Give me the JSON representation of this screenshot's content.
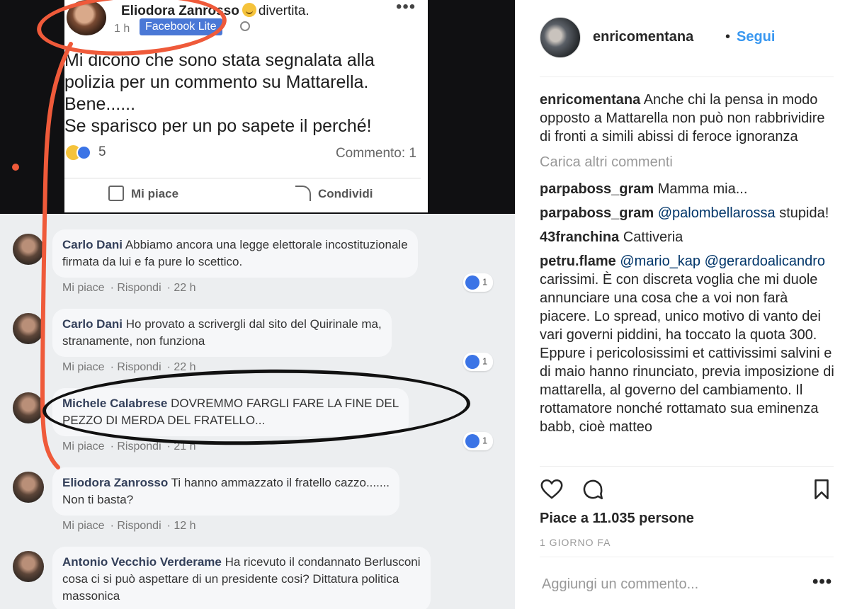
{
  "facebook_post": {
    "author": "Eliodora Zanrosso",
    "feeling": "divertita.",
    "time": "1 h",
    "app_badge": "Facebook Lite",
    "more": "•••",
    "lines": [
      "Mi dicono che sono stata segnalata alla",
      "polizia per un commento su Mattarella.",
      "Bene......",
      "Se sparisco per un po sapete il perché!"
    ],
    "reactions_count": "5",
    "comments_count": "Commento: 1",
    "like_label": "Mi piace",
    "share_label": "Condividi"
  },
  "facebook_comments": [
    {
      "name": "Carlo Dani",
      "text_lines": [
        "Abbiamo ancora una legge elettorale incostituzionale",
        "firmata da lui e fa pure lo scettico."
      ],
      "like": "Mi piace",
      "reply": "Rispondi",
      "time": "22 h",
      "reactions": "1"
    },
    {
      "name": "Carlo Dani",
      "text_lines": [
        "Ho provato a scrivergli dal sito del Quirinale ma,",
        "stranamente, non funziona"
      ],
      "like": "Mi piace",
      "reply": "Rispondi",
      "time": "22 h",
      "reactions": "1"
    },
    {
      "name": "Michele Calabrese",
      "text_lines": [
        "DOVREMMO FARGLI FARE LA FINE DEL",
        "PEZZO DI MERDA DEL FRATELLO..."
      ],
      "like": "Mi piace",
      "reply": "Rispondi",
      "time": "21 h",
      "reactions": "1"
    },
    {
      "name": "Eliodora Zanrosso",
      "text_lines": [
        "Ti hanno ammazzato il fratello cazzo.......",
        "Non ti basta?"
      ],
      "like": "Mi piace",
      "reply": "Rispondi",
      "time": "12 h",
      "reactions": ""
    },
    {
      "name": "Antonio Vecchio Verderame",
      "text_lines": [
        "Ha ricevuto il condannato Berlusconi",
        "cosa ci si può aspettare di un presidente cosi? Dittatura politica",
        "massonica"
      ],
      "like": "",
      "reply": "",
      "time": "",
      "reactions": ""
    }
  ],
  "instagram": {
    "username": "enricomentana",
    "dot": "•",
    "follow": "Segui",
    "caption_user": "enricomentana",
    "caption": "Anche chi la pensa in modo opposto a Mattarella non può non rabbrividire di fronti a simili abissi di feroce ignoranza",
    "load_more": "Carica altri commenti",
    "comments": [
      {
        "user": "parpaboss_gram",
        "mention": "",
        "text": "Mamma mia..."
      },
      {
        "user": "parpaboss_gram",
        "mention": "@palombellarossa",
        "text": "stupida!"
      },
      {
        "user": "43franchina",
        "mention": "",
        "text": "Cattiveria"
      },
      {
        "user": "petru.flame",
        "mention": "@mario_kap @gerardoalicandro",
        "text": "carissimi. È con discreta voglia che mi duole annunciare una cosa che a voi non farà piacere. Lo spread, unico motivo di vanto dei vari governi piddini, ha toccato la quota 300. Eppure i pericolosissimi et cattivissimi salvini e di maio hanno rinunciato, previa imposizione di mattarella, al governo del cambiamento. Il rottamatore nonché rottamato sua eminenza babb, cioè matteo"
      }
    ],
    "likes": "Piace a 11.035 persone",
    "date": "1 GIORNO FA",
    "comment_placeholder": "Aggiungi un commento...",
    "more": "•••",
    "icons": [
      "heart-icon",
      "comment-icon",
      "bookmark-icon"
    ]
  }
}
